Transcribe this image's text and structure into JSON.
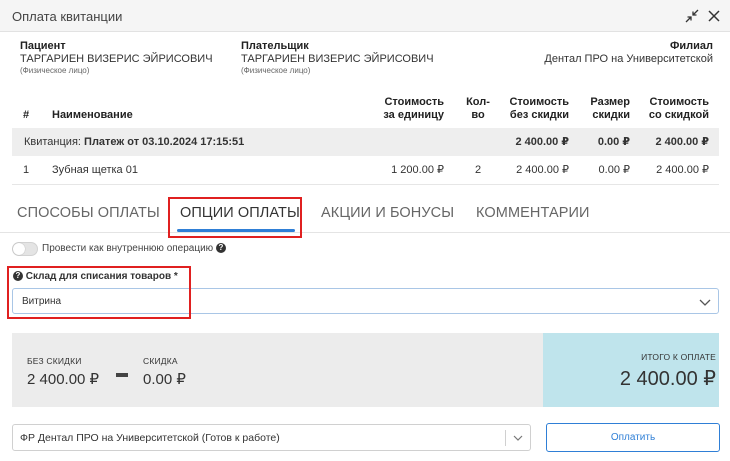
{
  "window": {
    "title": "Оплата квитанции"
  },
  "patient": {
    "label": "Пациент",
    "name": "ТАРГАРИЕН ВИЗЕРИС ЭЙРИСОВИЧ",
    "type": "(Физическое лицо)"
  },
  "payer": {
    "label": "Плательщик",
    "name": "ТАРГАРИЕН ВИЗЕРИС ЭЙРИСОВИЧ",
    "type": "(Физическое лицо)"
  },
  "branch": {
    "label": "Филиал",
    "name": "Дентал ПРО на Университетской"
  },
  "table": {
    "headers": {
      "num": "#",
      "name": "Наименование",
      "unit_price_1": "Стоимость",
      "unit_price_2": "за единицу",
      "qty_1": "Кол-",
      "qty_2": "во",
      "no_disc_1": "Стоимость",
      "no_disc_2": "без скидки",
      "disc_1": "Размер",
      "disc_2": "скидки",
      "with_disc_1": "Стоимость",
      "with_disc_2": "со скидкой"
    },
    "receipt": {
      "prefix": "Квитанция:",
      "name": "Платеж от 03.10.2024 17:15:51",
      "no_disc": "2 400.00 ₽",
      "disc": "0.00 ₽",
      "with_disc": "2 400.00 ₽"
    },
    "rows": [
      {
        "num": "1",
        "name": "Зубная щетка 01",
        "unit_price": "1 200.00 ₽",
        "qty": "2",
        "no_disc": "2 400.00 ₽",
        "disc": "0.00 ₽",
        "with_disc": "2 400.00 ₽"
      }
    ]
  },
  "tabs": [
    {
      "label": "СПОСОБЫ ОПЛАТЫ"
    },
    {
      "label": "ОПЦИИ ОПЛАТЫ",
      "active": true
    },
    {
      "label": "АКЦИИ И БОНУСЫ"
    },
    {
      "label": "КОММЕНТАРИИ"
    }
  ],
  "options": {
    "internal_toggle_label": "Провести как внутреннюю операцию",
    "internal_toggle_on": false,
    "warehouse_label": "Склад для списания товаров *",
    "warehouse_value": "Витрина"
  },
  "summary": {
    "no_disc_label": "БЕЗ СКИДКИ",
    "no_disc_value": "2 400.00 ₽",
    "disc_label": "СКИДКА",
    "disc_value": "0.00 ₽",
    "total_label": "ИТОГО К ОПЛАТЕ",
    "total_value": "2 400.00 ₽"
  },
  "footer": {
    "register_value": "ФР Дентал ПРО на Университетской (Готов к работе)",
    "pay_button": "Оплатить"
  },
  "colors": {
    "accent": "#2f7fd6",
    "highlight": "#e02020",
    "total_bg": "#bfe4ec",
    "summary_bg": "#ececec"
  }
}
